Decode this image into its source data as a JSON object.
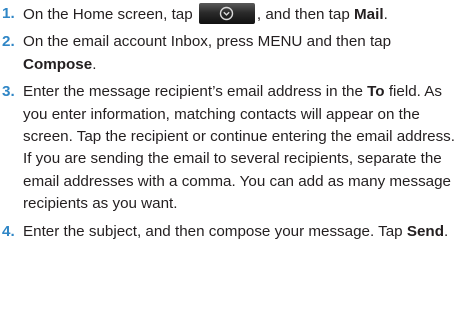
{
  "steps": [
    {
      "number": "1.",
      "t1": "On the Home screen, tap ",
      "icon": "all-apps-launcher-icon",
      "t2": ", and then tap ",
      "b1": "Mail",
      "t3": "."
    },
    {
      "number": "2.",
      "t1": "On the email account Inbox, press MENU and then tap ",
      "b1": "Compose",
      "t2": "."
    },
    {
      "number": "3.",
      "t1": "Enter the message recipient’s email address in the ",
      "b1": "To",
      "t2": " field. As you enter information, matching contacts will appear on the screen. Tap the recipient or continue entering the email address. If you are sending the email to several recipients, separate the email addresses with a comma. You can add as many message recipients as you want."
    },
    {
      "number": "4.",
      "t1": "Enter the subject, and then compose your message. Tap ",
      "b1": "Send",
      "t2": "."
    }
  ],
  "colors": {
    "step_number": "#2f86c6",
    "body_text": "#231f20"
  }
}
